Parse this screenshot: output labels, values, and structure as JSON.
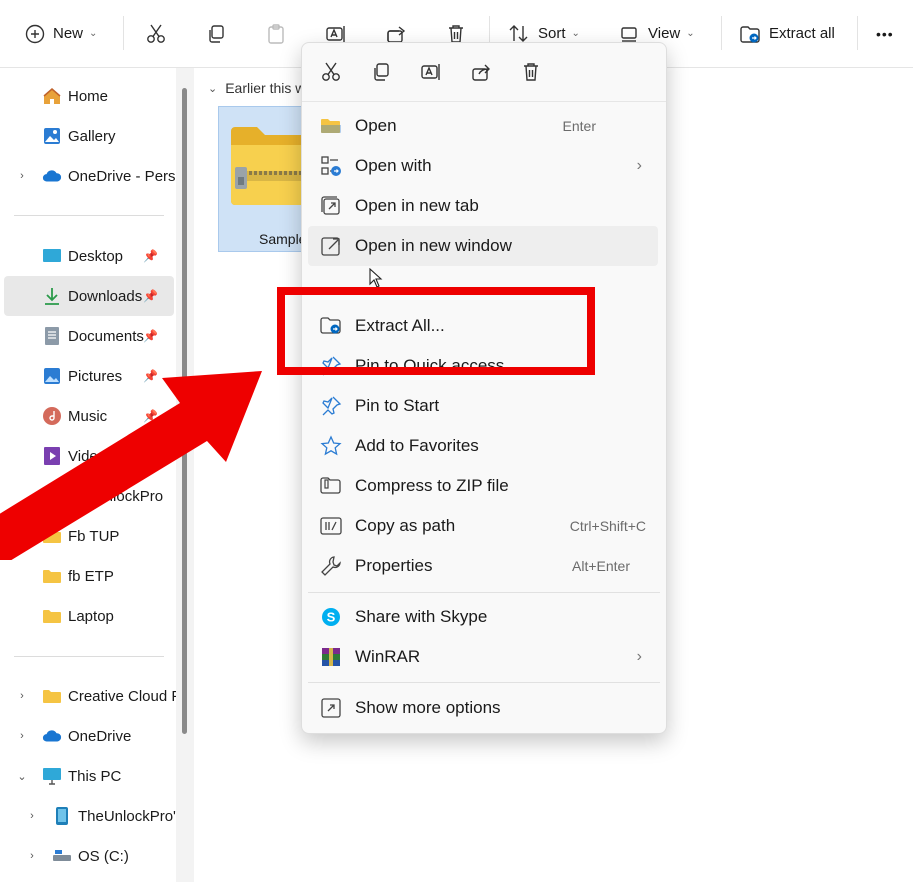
{
  "toolbar": {
    "new_label": "New",
    "sort_label": "Sort",
    "view_label": "View",
    "extract_label": "Extract all",
    "more_label": "•••"
  },
  "sidebar": {
    "items": [
      {
        "label": "Home"
      },
      {
        "label": "Gallery"
      },
      {
        "label": "OneDrive - Personal"
      },
      {
        "label": "Desktop"
      },
      {
        "label": "Downloads"
      },
      {
        "label": "Documents"
      },
      {
        "label": "Pictures"
      },
      {
        "label": "Music"
      },
      {
        "label": "Videos"
      },
      {
        "label": "TheUnlockPro"
      },
      {
        "label": "Fb TUP"
      },
      {
        "label": "fb ETP"
      },
      {
        "label": "Laptop"
      },
      {
        "label": "Creative Cloud Files"
      },
      {
        "label": "OneDrive"
      },
      {
        "label": "This PC"
      },
      {
        "label": "TheUnlockPro's"
      },
      {
        "label": "OS (C:)"
      }
    ]
  },
  "content": {
    "group_header": "Earlier this week",
    "file_name": "Sample"
  },
  "context_menu": {
    "items": [
      {
        "label": "Open",
        "shortcut": "Enter"
      },
      {
        "label": "Open with",
        "has_submenu": true
      },
      {
        "label": "Open in new tab"
      },
      {
        "label": "Open in new window"
      },
      {
        "label": "Extract All..."
      },
      {
        "label": "Pin to Quick access"
      },
      {
        "label": "Pin to Start"
      },
      {
        "label": "Add to Favorites"
      },
      {
        "label": "Compress to ZIP file"
      },
      {
        "label": "Copy as path",
        "shortcut": "Ctrl+Shift+C"
      },
      {
        "label": "Properties",
        "shortcut": "Alt+Enter"
      },
      {
        "label": "Share with Skype"
      },
      {
        "label": "WinRAR",
        "has_submenu": true
      },
      {
        "label": "Show more options"
      }
    ]
  },
  "colors": {
    "highlight": "#ee0000",
    "selection": "#cfe2f6",
    "accent": "#0067c0"
  }
}
